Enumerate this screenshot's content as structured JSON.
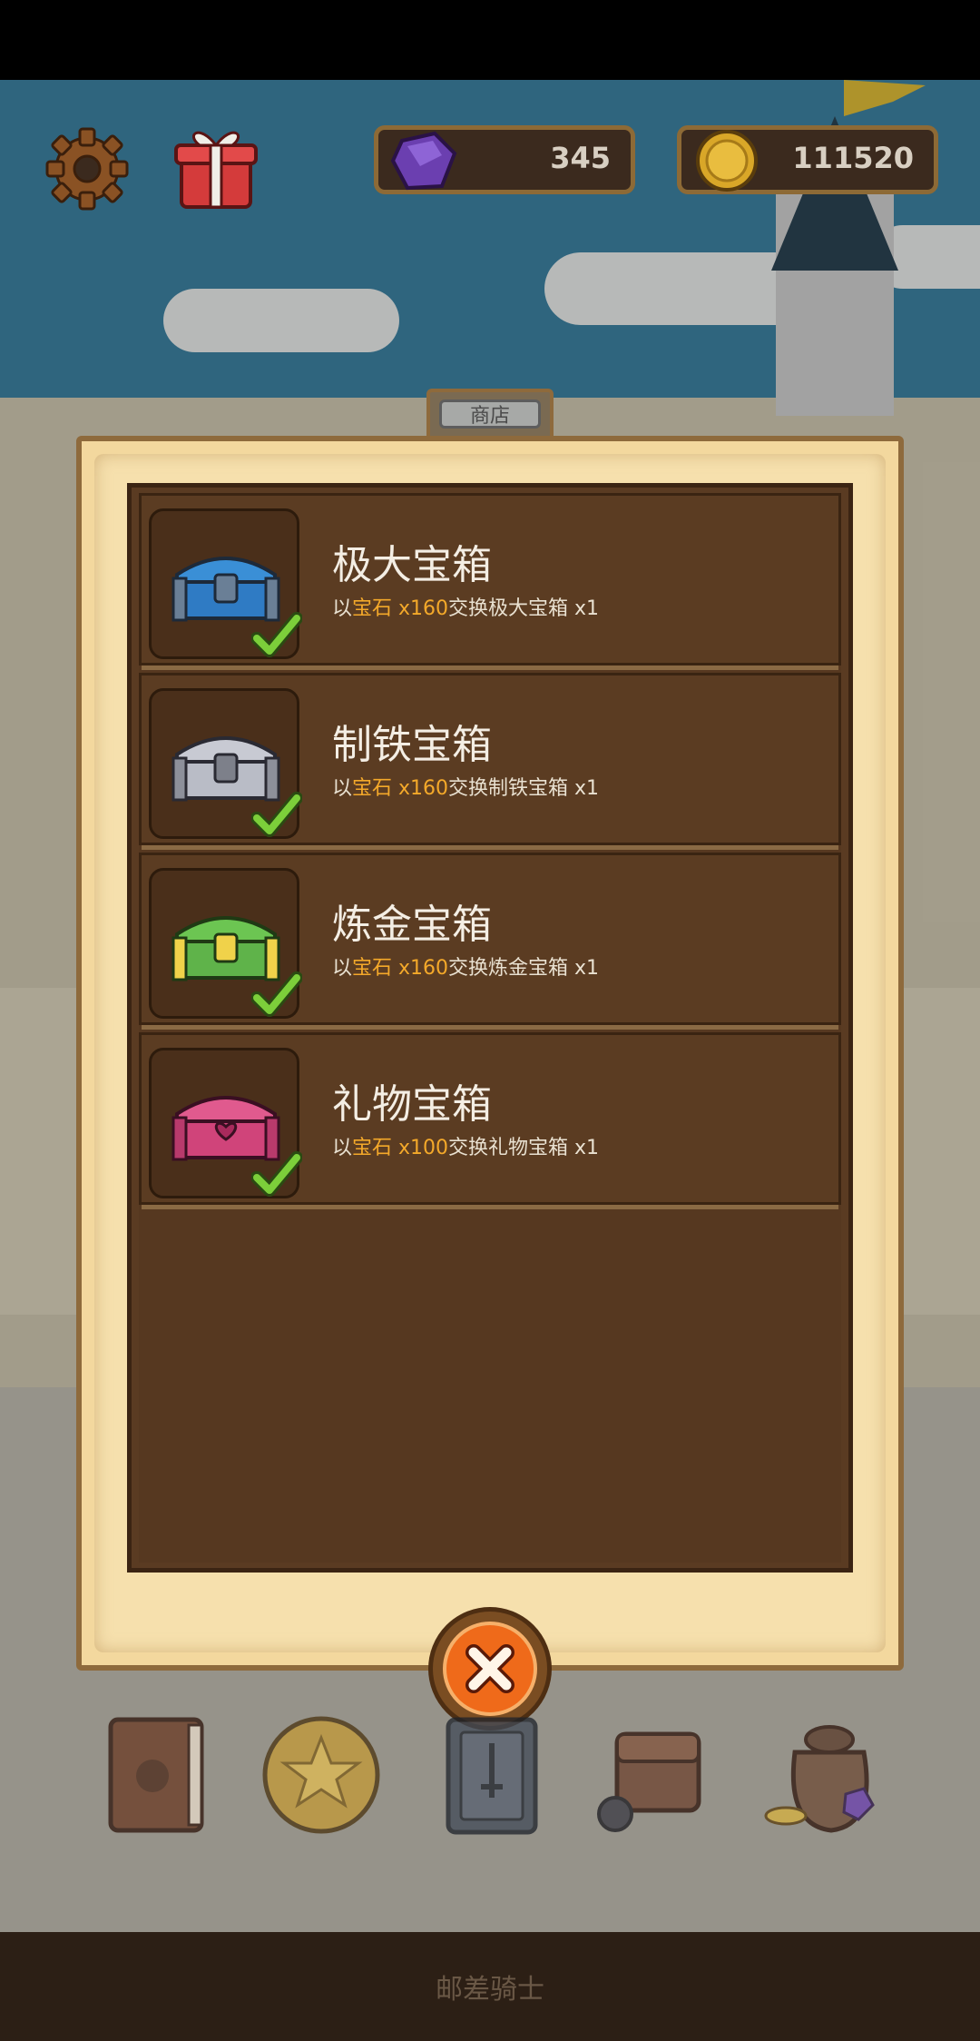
{
  "currency": {
    "gems": "345",
    "coins": "111520",
    "gem_icon": "purple-gem-icon",
    "coin_icon": "gold-coin-icon"
  },
  "hud": {
    "settings_icon": "gear-icon",
    "gift_icon": "gift-box-icon"
  },
  "shop": {
    "title": "商店",
    "items": [
      {
        "name": "极大宝箱",
        "desc_prefix": "以",
        "currency_name": "宝石",
        "cost": " x160",
        "desc_suffix": "交换极大宝箱 x1",
        "chest_color": "#3a8fd6",
        "owned": true
      },
      {
        "name": "制铁宝箱",
        "desc_prefix": "以",
        "currency_name": "宝石",
        "cost": " x160",
        "desc_suffix": "交换制铁宝箱 x1",
        "chest_color": "#b9bcc6",
        "owned": true
      },
      {
        "name": "炼金宝箱",
        "desc_prefix": "以",
        "currency_name": "宝石",
        "cost": " x160",
        "desc_suffix": "交换炼金宝箱 x1",
        "chest_color": "#5fb34a",
        "owned": true
      },
      {
        "name": "礼物宝箱",
        "desc_prefix": "以",
        "currency_name": "宝石",
        "cost": " x100",
        "desc_suffix": "交换礼物宝箱 x1",
        "chest_color": "#d0447a",
        "owned": true
      }
    ],
    "close_icon": "close-x-icon"
  },
  "nav": {
    "items": [
      "book-icon",
      "star-coin-icon",
      "card-deck-icon",
      "backpack-icon",
      "treasure-bag-icon"
    ]
  },
  "footer": {
    "title": "邮差骑士"
  },
  "colors": {
    "highlight": "#f4a92a",
    "panel": "#5b3c22",
    "parchment": "#f3d89e",
    "check": "#7ccf3a"
  }
}
